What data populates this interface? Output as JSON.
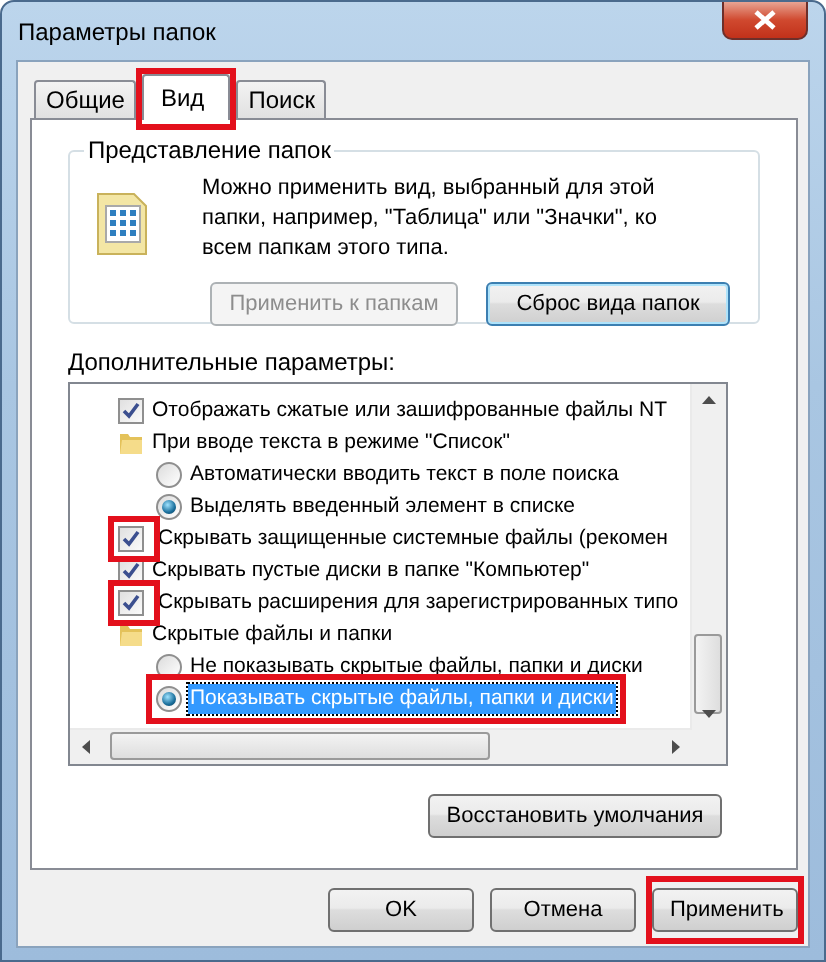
{
  "window": {
    "title": "Параметры папок"
  },
  "tabs": [
    {
      "label": "Общие",
      "selected": false,
      "highlighted": false
    },
    {
      "label": "Вид",
      "selected": true,
      "highlighted": true
    },
    {
      "label": "Поиск",
      "selected": false,
      "highlighted": false
    }
  ],
  "folder_views": {
    "title": "Представление папок",
    "description": "Можно применить вид, выбранный для этой папки, например, \"Таблица\" или \"Значки\", ко всем папкам этого типа.",
    "buttons": [
      {
        "label": "Применить к папкам",
        "disabled": true,
        "focused": false
      },
      {
        "label": "Сброс вида папок",
        "disabled": false,
        "focused": true
      }
    ]
  },
  "advanced": {
    "label": "Дополнительные параметры:",
    "items": [
      {
        "kind": "checkbox",
        "label": "Отображать сжатые или зашифрованные файлы NT",
        "checked": true,
        "selected": false,
        "highlighted": false
      },
      {
        "kind": "folder",
        "label": "При вводе текста в режиме \"Список\"",
        "selected": false,
        "children": [
          {
            "kind": "radio",
            "label": "Автоматически вводить текст в поле поиска",
            "checked": false,
            "selected": false,
            "highlighted": false
          },
          {
            "kind": "radio",
            "label": "Выделять введенный элемент в списке",
            "checked": true,
            "selected": false,
            "highlighted": false
          }
        ]
      },
      {
        "kind": "checkbox",
        "label": "Скрывать защищенные системные файлы (рекомен",
        "checked": true,
        "selected": false,
        "highlighted": true
      },
      {
        "kind": "checkbox",
        "label": "Скрывать пустые диски в папке \"Компьютер\"",
        "checked": true,
        "selected": false,
        "highlighted": false
      },
      {
        "kind": "checkbox",
        "label": "Скрывать расширения для зарегистрированных типо",
        "checked": true,
        "selected": false,
        "highlighted": true
      },
      {
        "kind": "folder",
        "label": "Скрытые файлы и папки",
        "selected": false,
        "children": [
          {
            "kind": "radio",
            "label": "Не показывать скрытые файлы, папки и диски",
            "checked": false,
            "selected": false,
            "highlighted": false
          },
          {
            "kind": "radio",
            "label": "Показывать скрытые файлы, папки и диски",
            "checked": true,
            "selected": true,
            "highlighted": true
          }
        ]
      }
    ]
  },
  "restore_button": {
    "label": "Восстановить умолчания"
  },
  "buttons": [
    {
      "label": "OK",
      "highlighted": false
    },
    {
      "label": "Отмена",
      "highlighted": false
    },
    {
      "label": "Применить",
      "highlighted": true
    }
  ]
}
